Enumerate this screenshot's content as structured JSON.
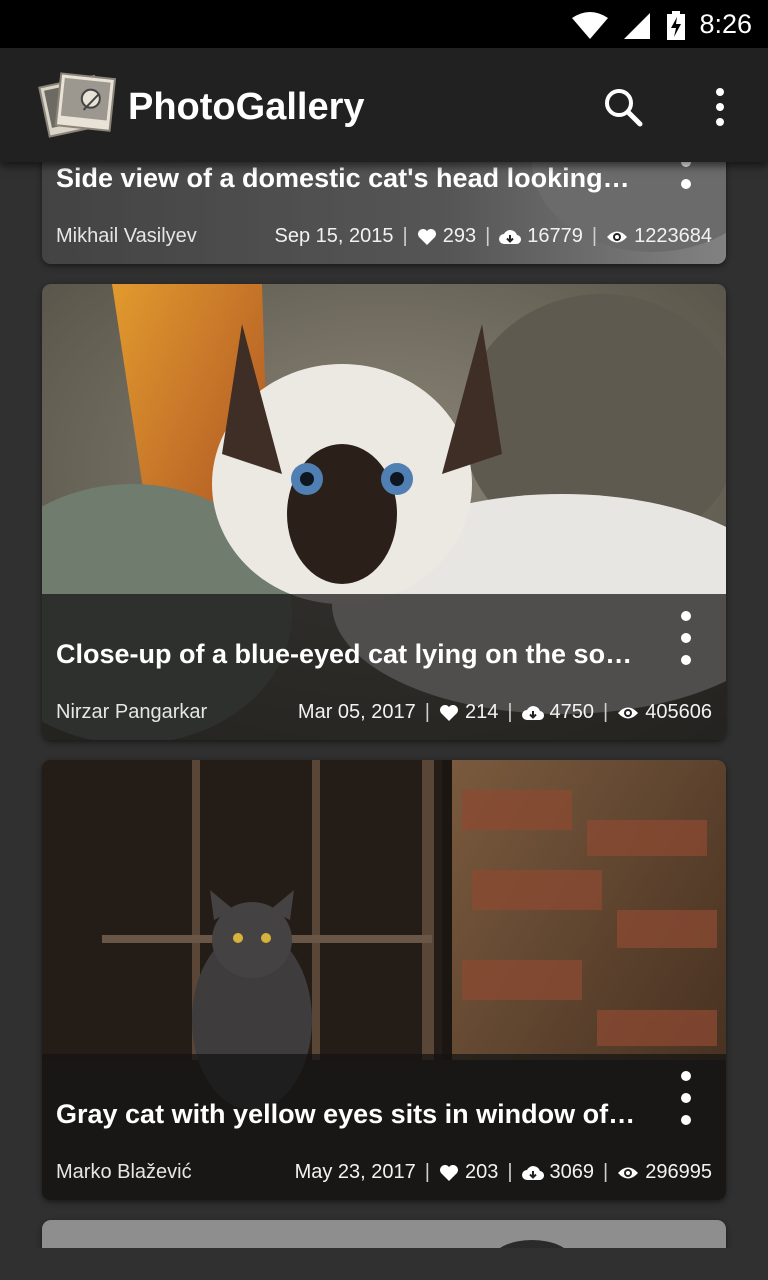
{
  "status_bar": {
    "time": "8:26",
    "icons": [
      "wifi-icon",
      "cellular-signal-icon",
      "battery-charging-icon"
    ]
  },
  "app_bar": {
    "title": "PhotoGallery",
    "icons": [
      "photo-gallery-logo",
      "search-icon",
      "overflow-menu-icon"
    ]
  },
  "photos": [
    {
      "caption": "Side view of a domestic cat's head looking…",
      "author": "Mikhail Vasilyev",
      "date": "Sep 15, 2015",
      "likes": "293",
      "downloads": "16779",
      "views": "1223684"
    },
    {
      "caption": "Close-up of a blue-eyed cat lying on the sofa…",
      "author": "Nirzar Pangarkar",
      "date": "Mar 05, 2017",
      "likes": "214",
      "downloads": "4750",
      "views": "405606"
    },
    {
      "caption": "Gray cat with yellow eyes sits in window of o…",
      "author": "Marko Blažević",
      "date": "May 23, 2017",
      "likes": "203",
      "downloads": "3069",
      "views": "296995"
    }
  ],
  "stat_icons": [
    "heart-icon",
    "cloud-download-icon",
    "eye-icon"
  ],
  "colors": {
    "app_bar": "#212121",
    "background": "#303030",
    "status_bar": "#000000"
  }
}
